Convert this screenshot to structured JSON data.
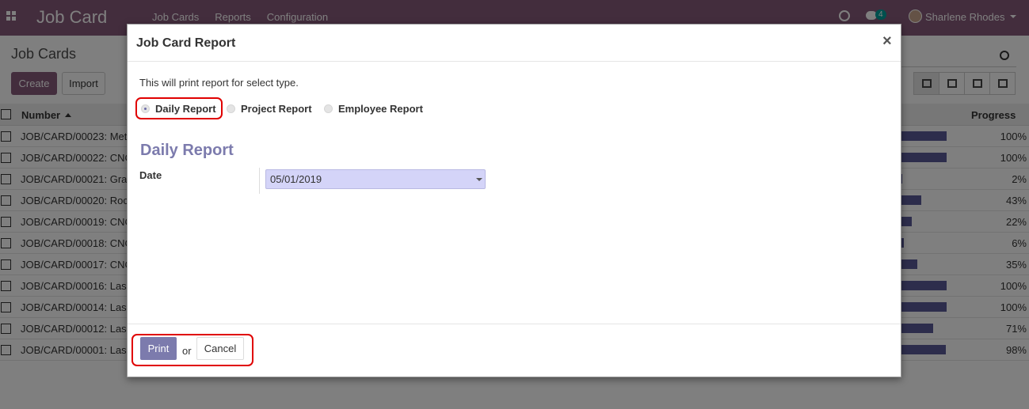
{
  "app": {
    "title": "Job Card",
    "menu": [
      "Job Cards",
      "Reports",
      "Configuration"
    ],
    "notification_count": "4",
    "user_name": "Sharlene Rhodes",
    "brand_color": "#875A7B"
  },
  "control_panel": {
    "breadcrumb": "Job Cards",
    "create_label": "Create",
    "import_label": "Import"
  },
  "list": {
    "columns": {
      "number": "Number",
      "progress": "Progress"
    },
    "rows": [
      {
        "number": "JOB/CARD/00023: Met",
        "progress": "100%",
        "value": 1.0
      },
      {
        "number": "JOB/CARD/00022: CNC",
        "progress": "100%",
        "value": 1.0
      },
      {
        "number": "JOB/CARD/00021: Gra",
        "progress": "2%",
        "value": 0.02
      },
      {
        "number": "JOB/CARD/00020: Roc",
        "progress": "43%",
        "value": 0.43
      },
      {
        "number": "JOB/CARD/00019: CNC",
        "progress": "22%",
        "value": 0.22
      },
      {
        "number": "JOB/CARD/00018: CNC",
        "progress": "6%",
        "value": 0.06
      },
      {
        "number": "JOB/CARD/00017: CNC",
        "progress": "35%",
        "value": 0.35
      },
      {
        "number": "JOB/CARD/00016: Las",
        "progress": "100%",
        "value": 1.0
      },
      {
        "number": "JOB/CARD/00014: Las",
        "progress": "100%",
        "value": 1.0
      },
      {
        "number": "JOB/CARD/00012: Las",
        "progress": "71%",
        "value": 0.71
      },
      {
        "number": "JOB/CARD/00001: Las",
        "progress": "98%",
        "value": 0.98
      }
    ]
  },
  "modal": {
    "title": "Job Card Report",
    "close_symbol": "×",
    "intro": "This will print report for select type.",
    "report_types": [
      {
        "label": "Daily Report",
        "selected": true
      },
      {
        "label": "Project Report",
        "selected": false
      },
      {
        "label": "Employee Report",
        "selected": false
      }
    ],
    "section_title": "Daily Report",
    "date_label": "Date",
    "date_value": "05/01/2019",
    "print_label": "Print",
    "or_label": "or",
    "cancel_label": "Cancel",
    "accent_color": "#7c7bad",
    "highlight_color": "#e00000"
  }
}
